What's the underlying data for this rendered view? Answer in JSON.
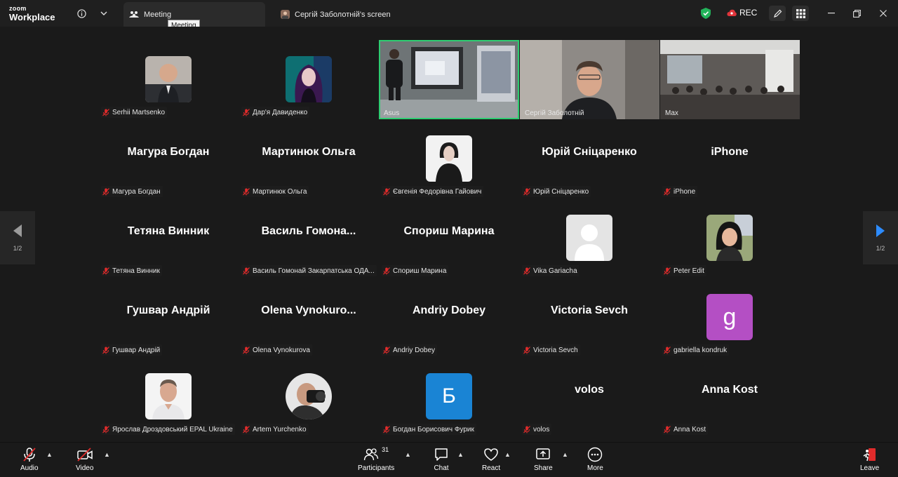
{
  "titlebar": {
    "logo_top": "zoom",
    "logo_bottom": "Workplace",
    "tab_meeting": "Meeting",
    "tab_screen": "Сергій Заболотній's screen",
    "tooltip": "Meeting",
    "rec_label": "REC"
  },
  "gallery": {
    "row1": [
      {
        "name": "Serhii Martsenko"
      },
      {
        "name": "Дар'я Давиденко"
      },
      {
        "name": "Asus"
      },
      {
        "name": "Сергій Заболотній"
      },
      {
        "name": "Max"
      }
    ],
    "row2": [
      {
        "center": "Магура Богдан",
        "name": "Магура Богдан"
      },
      {
        "center": "Мартинюк Ольга",
        "name": "Мартинюк Ольга"
      },
      {
        "name": "Євгенія Федорівна Гайович"
      },
      {
        "center": "Юрій Сніцаренко",
        "name": "Юрій Сніцаренко"
      },
      {
        "center": "iPhone",
        "name": "iPhone"
      }
    ],
    "row3": [
      {
        "center": "Тетяна Винник",
        "name": "Тетяна Винник"
      },
      {
        "center": "Василь Гомона...",
        "name": "Василь Гомонай Закарпатська ОДА..."
      },
      {
        "center": "Спориш Марина",
        "name": "Спориш Марина"
      },
      {
        "name": "Vika Gariacha"
      },
      {
        "name": "Peter Edit"
      }
    ],
    "row4": [
      {
        "center": "Гушвар Андрій",
        "name": "Гушвар Андрій"
      },
      {
        "center": "Olena Vynokuro...",
        "name": "Olena Vynokurova"
      },
      {
        "center": "Andriy Dobey",
        "name": "Andriy Dobey"
      },
      {
        "center": "Victoria Sevch",
        "name": "Victoria Sevch"
      },
      {
        "letter": "g",
        "name": "gabriella kondruk"
      }
    ],
    "row5": [
      {
        "name": "Ярослав Дроздовський EPAL Ukraine"
      },
      {
        "name": "Artem Yurchenko"
      },
      {
        "letter": "Б",
        "name": "Богдан Борисович Фурик"
      },
      {
        "center": "volos",
        "name": "volos"
      },
      {
        "center": "Anna Kost",
        "name": "Anna Kost"
      }
    ],
    "page_left": "1/2",
    "page_right": "1/2"
  },
  "toolbar": {
    "audio": "Audio",
    "video": "Video",
    "participants": "Participants",
    "participants_count": "31",
    "chat": "Chat",
    "react": "React",
    "share": "Share",
    "more": "More",
    "leave": "Leave"
  },
  "colors": {
    "accent_green": "#2ecc71",
    "rec_red": "#e0353b",
    "avatar_purple": "#b44fc4",
    "avatar_blue": "#1a84d4",
    "nav_arrow_blue": "#2d8cff"
  }
}
